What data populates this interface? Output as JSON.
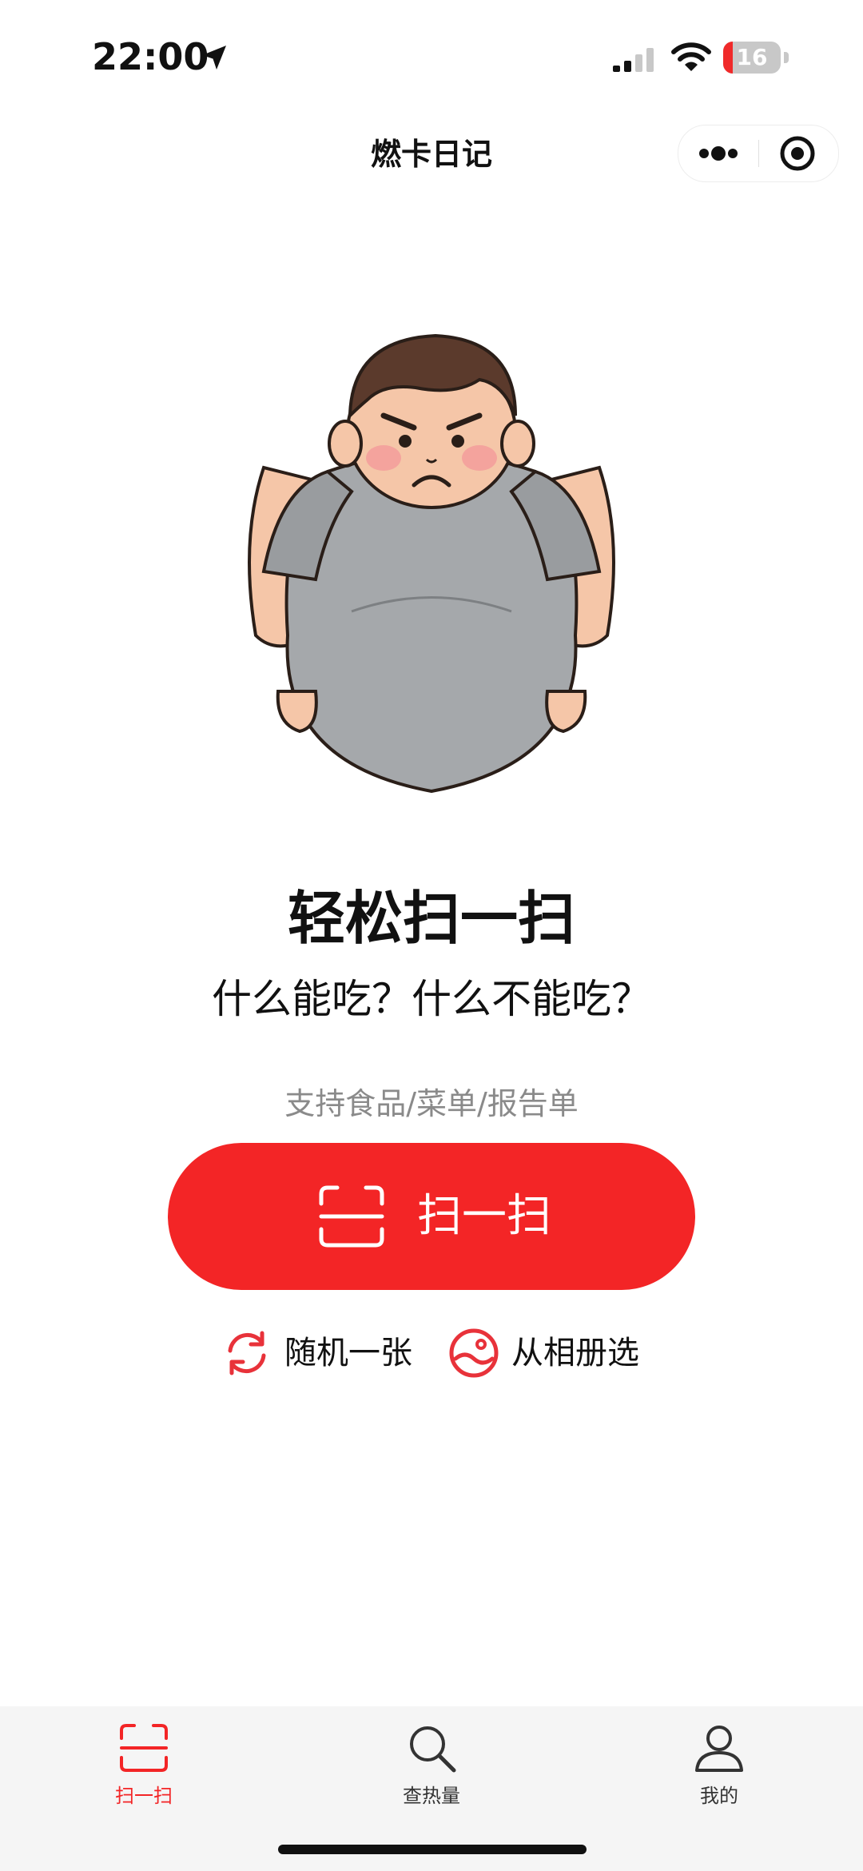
{
  "status_bar": {
    "time": "22:00",
    "battery_level": "16",
    "battery_fraction": 0.16,
    "icons": [
      "location-icon",
      "signal-icon",
      "wifi-icon",
      "battery-icon"
    ]
  },
  "nav": {
    "title": "燃卡日记",
    "icons": [
      "more-icon",
      "close-target-icon"
    ]
  },
  "hero": {
    "image": "angry-chubby-boy-illustration",
    "headline": "轻松扫一扫",
    "subheadline": "什么能吃？什么不能吃？",
    "support_text": "支持食品/菜单/报告单"
  },
  "primary_action": {
    "label": "扫一扫",
    "icon": "scan-frame-icon"
  },
  "secondary_actions": [
    {
      "label": "随机一张",
      "icon": "refresh-icon"
    },
    {
      "label": "从相册选",
      "icon": "album-icon"
    }
  ],
  "tabs": [
    {
      "label": "扫一扫",
      "icon": "scan-frame-icon",
      "active": true
    },
    {
      "label": "查热量",
      "icon": "search-icon",
      "active": false
    },
    {
      "label": "我的",
      "icon": "user-icon",
      "active": false
    }
  ],
  "colors": {
    "accent": "#f32526",
    "text_primary": "#111111",
    "text_secondary": "#8a8a8a",
    "tab_inactive": "#333333",
    "tab_bar_bg": "#f5f5f5"
  }
}
